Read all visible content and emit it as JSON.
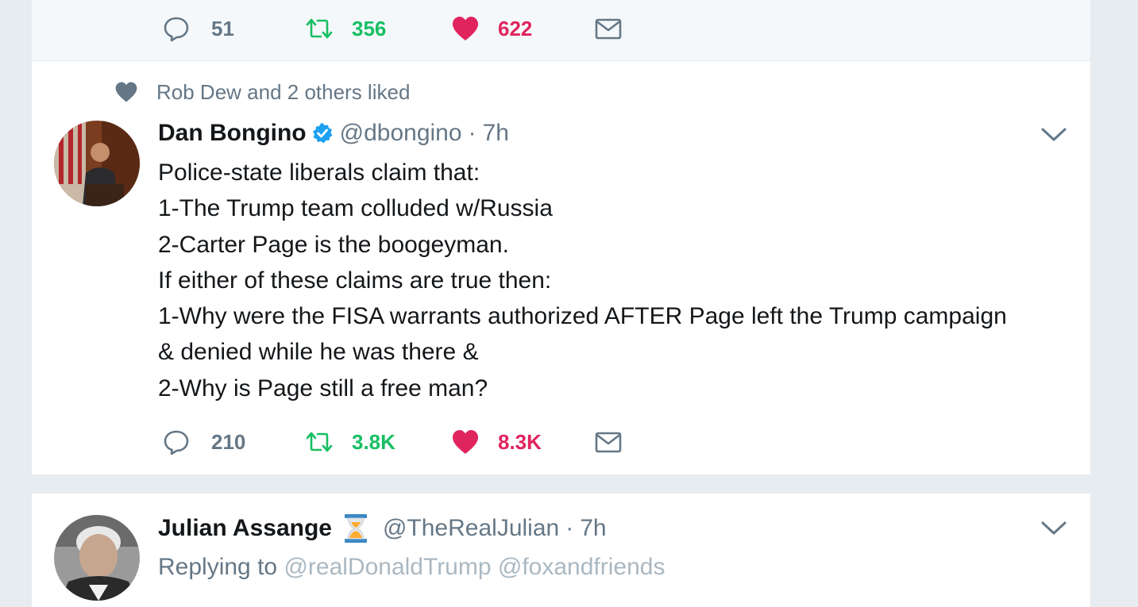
{
  "colors": {
    "background": "#e6ecf0",
    "card": "#ffffff",
    "text_primary": "#14171a",
    "text_secondary": "#657786",
    "retweet_green": "#17bf63",
    "like_red": "#e0245e",
    "verified_blue": "#1da1f2"
  },
  "tweets": [
    {
      "actions": {
        "reply_count": "51",
        "retweet_count": "356",
        "like_count": "622",
        "icons": [
          "reply-icon",
          "retweet-icon",
          "heart-icon",
          "envelope-icon"
        ]
      }
    },
    {
      "social_context": "Rob Dew and 2 others liked",
      "author": {
        "name": "Dan Bongino",
        "handle": "@dbongino",
        "verified": true
      },
      "separator": "·",
      "time": "7h",
      "text_lines": [
        "Police-state liberals claim that:",
        "1-The Trump team colluded w/Russia",
        "2-Carter Page is the boogeyman.",
        "If either of these claims are true then:",
        "1-Why were the FISA warrants authorized AFTER Page left the Trump campaign",
        "& denied while he was there &",
        "2-Why is Page still a free man?"
      ],
      "actions": {
        "reply_count": "210",
        "retweet_count": "3.8K",
        "like_count": "8.3K"
      }
    },
    {
      "author": {
        "name": "Julian Assange",
        "emoji": "hourglass-icon",
        "handle": "@TheRealJulian"
      },
      "separator": "·",
      "time": "7h",
      "reply_prefix": "Replying to",
      "reply_to": [
        "@realDonaldTrump",
        "@foxandfriends"
      ]
    }
  ]
}
